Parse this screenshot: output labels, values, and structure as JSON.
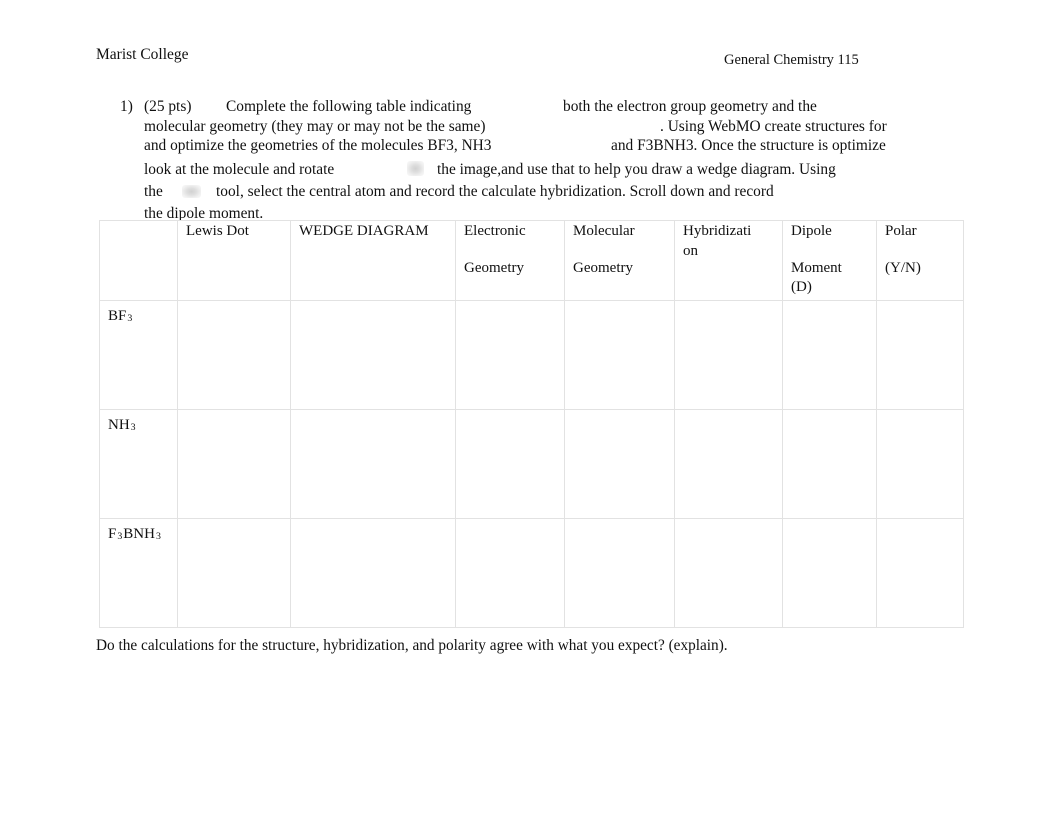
{
  "header": {
    "institution": "Marist College",
    "course": "General Chemistry 115"
  },
  "question": {
    "number": "1)",
    "points": "(25 pts)",
    "line1_a": "Complete the following table indicating",
    "line1_b": "both the electron group geometry and the",
    "line2_a": "molecular geometry (they may or may not be the same)",
    "line2_b": ". Using WebMO create structures for",
    "line3_a": "and optimize the geometries of the molecules BF3, NH3",
    "line3_b": "and F3BNH3. Once the structure is optimize",
    "line4_a": "look at the molecule and rotate",
    "line4_b": "the image,and use that to help you draw a wedge diagram. Using",
    "line5_a": "the",
    "line5_b": "tool, select the central atom and record the calculate hybridization. Scroll down and record",
    "line6": "the dipole moment.",
    "placeholder_rotate": "rotate-image-placeholder",
    "placeholder_tool": "tool-image-placeholder"
  },
  "table": {
    "headers": [
      {
        "line1": "",
        "line2": ""
      },
      {
        "line1": "Lewis Dot",
        "line2": ""
      },
      {
        "line1": "WEDGE DIAGRAM",
        "line2": ""
      },
      {
        "line1": "Electronic",
        "line2": "Geometry"
      },
      {
        "line1": "Molecular",
        "line2": "Geometry"
      },
      {
        "line1": "Hybridizati",
        "line2": "on"
      },
      {
        "line1": "Dipole",
        "line2": "Moment",
        "line3": "(D)"
      },
      {
        "line1": "Polar",
        "line2": "(Y/N)"
      }
    ],
    "rows": [
      {
        "label_parts": [
          {
            "text": "BF",
            "sub": false
          },
          {
            "text": "3",
            "sub": true
          }
        ],
        "cells": [
          "",
          "",
          "",
          "",
          "",
          "",
          ""
        ]
      },
      {
        "label_parts": [
          {
            "text": "NH",
            "sub": false
          },
          {
            "text": "3",
            "sub": true
          }
        ],
        "cells": [
          "",
          "",
          "",
          "",
          "",
          "",
          ""
        ]
      },
      {
        "label_parts": [
          {
            "text": "F",
            "sub": false
          },
          {
            "text": "3",
            "sub": true
          },
          {
            "text": "BNH",
            "sub": false
          },
          {
            "text": "3",
            "sub": true
          }
        ],
        "cells": [
          "",
          "",
          "",
          "",
          "",
          "",
          ""
        ]
      }
    ]
  },
  "closing": {
    "text": "Do the calculations for the structure, hybridization, and polarity agree with what you expect? (explain)."
  },
  "colors": {
    "page_background": "#ffffff",
    "text": "#111111",
    "table_border": "#e2e2e2",
    "placeholder_gray": "#d8d8d8"
  }
}
